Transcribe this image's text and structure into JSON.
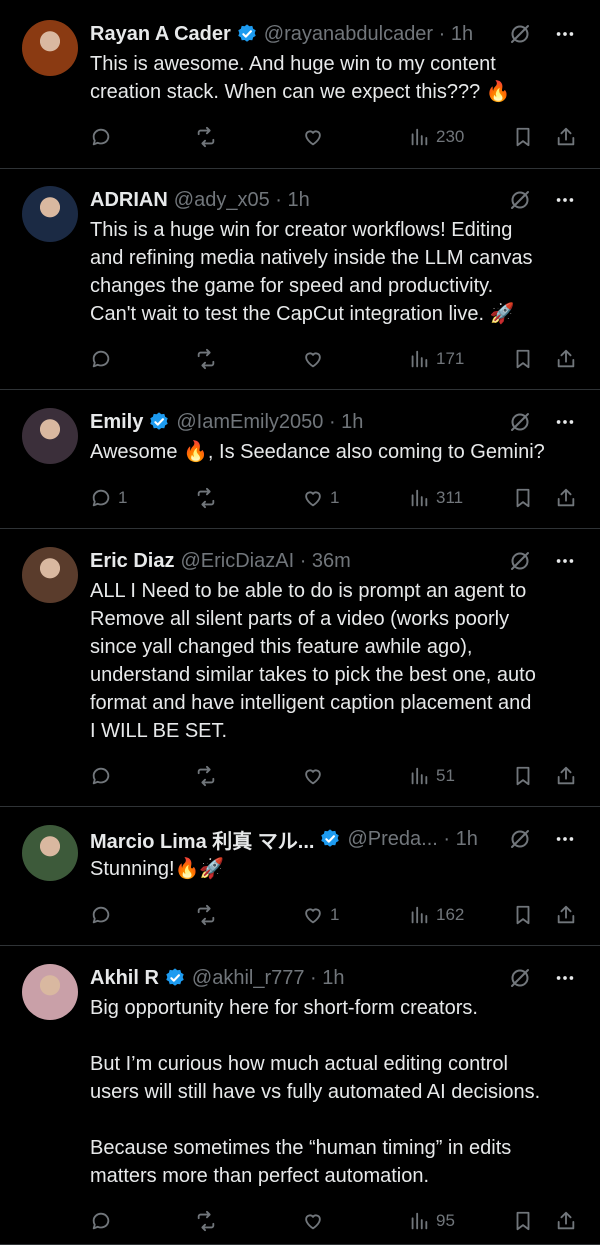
{
  "tweets": [
    {
      "name": "Rayan A Cader",
      "verified": true,
      "handle": "@rayanabdulcader · 1h",
      "text": "This is awesome. And huge win to my content\ncreation stack. When can we expect this??? 🔥",
      "replies": "",
      "likes": "",
      "views": "230",
      "avatar_color": "#8a3a12"
    },
    {
      "name": "ADRIAN",
      "verified": false,
      "handle": "@ady_x05 · 1h",
      "text": "This is a huge win for creator workflows! Editing\nand refining media natively inside the LLM canvas\nchanges the game for speed and productivity.\nCan't wait to test the CapCut integration live. 🚀",
      "replies": "",
      "likes": "",
      "views": "171",
      "avatar_color": "#1b2a44"
    },
    {
      "name": "Emily",
      "verified": true,
      "handle": "@IamEmily2050 · 1h",
      "text": "Awesome 🔥, Is Seedance also coming to Gemini?",
      "replies": "1",
      "likes": "1",
      "views": "311",
      "avatar_color": "#3b2f3a"
    },
    {
      "name": "Eric Diaz",
      "verified": false,
      "handle": "@EricDiazAI · 36m",
      "text": "ALL I Need to be able to do is prompt an agent to\nRemove all silent parts of a video (works poorly\nsince yall changed this feature awhile ago),\nunderstand similar takes to pick the best one, auto\nformat and have intelligent caption placement and\nI WILL BE SET.",
      "replies": "",
      "likes": "",
      "views": "51",
      "avatar_color": "#5a3c2c"
    },
    {
      "name": "Marcio Lima 利真 マル...",
      "verified": true,
      "handle": "@Preda... · 1h",
      "text": "Stunning!🔥🚀",
      "replies": "",
      "likes": "1",
      "views": "162",
      "avatar_color": "#3d5a3a"
    },
    {
      "name": "Akhil R",
      "verified": true,
      "handle": "@akhil_r777 · 1h",
      "text": "Big opportunity here for short-form creators.\n\nBut I’m curious how much actual editing control\nusers will still have vs fully automated AI decisions.\n\nBecause sometimes the “human timing” in edits\nmatters more than perfect automation.",
      "replies": "",
      "likes": "",
      "views": "95",
      "avatar_color": "#c9a0a8"
    }
  ],
  "colors": {
    "background": "#000000",
    "text": "#e7e9ea",
    "muted": "#71767b",
    "verified": "#1d9bf0",
    "divider": "#2f3336"
  }
}
